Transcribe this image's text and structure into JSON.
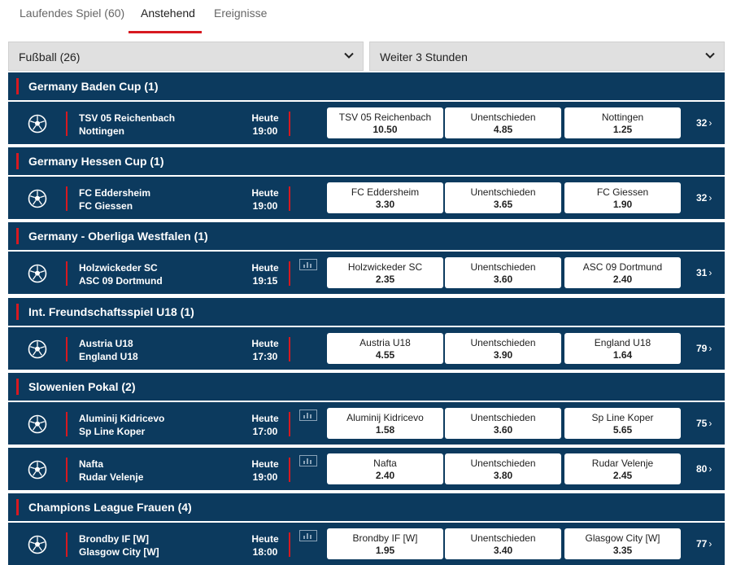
{
  "tabs": [
    {
      "label": "Laufendes Spiel (60)"
    },
    {
      "label": "Anstehend"
    },
    {
      "label": "Ereignisse"
    }
  ],
  "filters": {
    "sport": "Fußball (26)",
    "time": "Weiter 3 Stunden"
  },
  "sections": [
    {
      "title": "Germany Baden Cup (1)"
    },
    {
      "title": "Germany Hessen Cup (1)"
    },
    {
      "title": "Germany - Oberliga Westfalen (1)"
    },
    {
      "title": "Int. Freundschaftsspiel U18 (1)"
    },
    {
      "title": "Slowenien Pokal (2)"
    },
    {
      "title": "Champions League Frauen (4)"
    }
  ],
  "matches": [
    {
      "home": "TSV 05 Reichenbach",
      "away": "Nottingen",
      "day": "Heute",
      "time": "19:00",
      "odds": [
        {
          "name": "TSV 05 Reichenbach",
          "value": "10.50"
        },
        {
          "name": "Unentschieden",
          "value": "4.85"
        },
        {
          "name": "Nottingen",
          "value": "1.25"
        }
      ],
      "more": "32",
      "stats": false
    },
    {
      "home": "FC Eddersheim",
      "away": "FC Giessen",
      "day": "Heute",
      "time": "19:00",
      "odds": [
        {
          "name": "FC Eddersheim",
          "value": "3.30"
        },
        {
          "name": "Unentschieden",
          "value": "3.65"
        },
        {
          "name": "FC Giessen",
          "value": "1.90"
        }
      ],
      "more": "32",
      "stats": false
    },
    {
      "home": "Holzwickeder SC",
      "away": "ASC 09 Dortmund",
      "day": "Heute",
      "time": "19:15",
      "odds": [
        {
          "name": "Holzwickeder SC",
          "value": "2.35"
        },
        {
          "name": "Unentschieden",
          "value": "3.60"
        },
        {
          "name": "ASC 09 Dortmund",
          "value": "2.40"
        }
      ],
      "more": "31",
      "stats": true
    },
    {
      "home": "Austria U18",
      "away": "England U18",
      "day": "Heute",
      "time": "17:30",
      "odds": [
        {
          "name": "Austria U18",
          "value": "4.55"
        },
        {
          "name": "Unentschieden",
          "value": "3.90"
        },
        {
          "name": "England U18",
          "value": "1.64"
        }
      ],
      "more": "79",
      "stats": false
    },
    {
      "home": "Aluminij Kidricevo",
      "away": "Sp Line Koper",
      "day": "Heute",
      "time": "17:00",
      "odds": [
        {
          "name": "Aluminij Kidricevo",
          "value": "1.58"
        },
        {
          "name": "Unentschieden",
          "value": "3.60"
        },
        {
          "name": "Sp Line Koper",
          "value": "5.65"
        }
      ],
      "more": "75",
      "stats": true
    },
    {
      "home": "Nafta",
      "away": "Rudar Velenje",
      "day": "Heute",
      "time": "19:00",
      "odds": [
        {
          "name": "Nafta",
          "value": "2.40"
        },
        {
          "name": "Unentschieden",
          "value": "3.80"
        },
        {
          "name": "Rudar Velenje",
          "value": "2.45"
        }
      ],
      "more": "80",
      "stats": true
    },
    {
      "home": "Brondby IF [W]",
      "away": "Glasgow City [W]",
      "day": "Heute",
      "time": "18:00",
      "odds": [
        {
          "name": "Brondby IF [W]",
          "value": "1.95"
        },
        {
          "name": "Unentschieden",
          "value": "3.40"
        },
        {
          "name": "Glasgow City [W]",
          "value": "3.35"
        }
      ],
      "more": "77",
      "stats": true
    }
  ],
  "colors": {
    "header_bg": "#0c3a5e",
    "accent": "#d71920"
  }
}
